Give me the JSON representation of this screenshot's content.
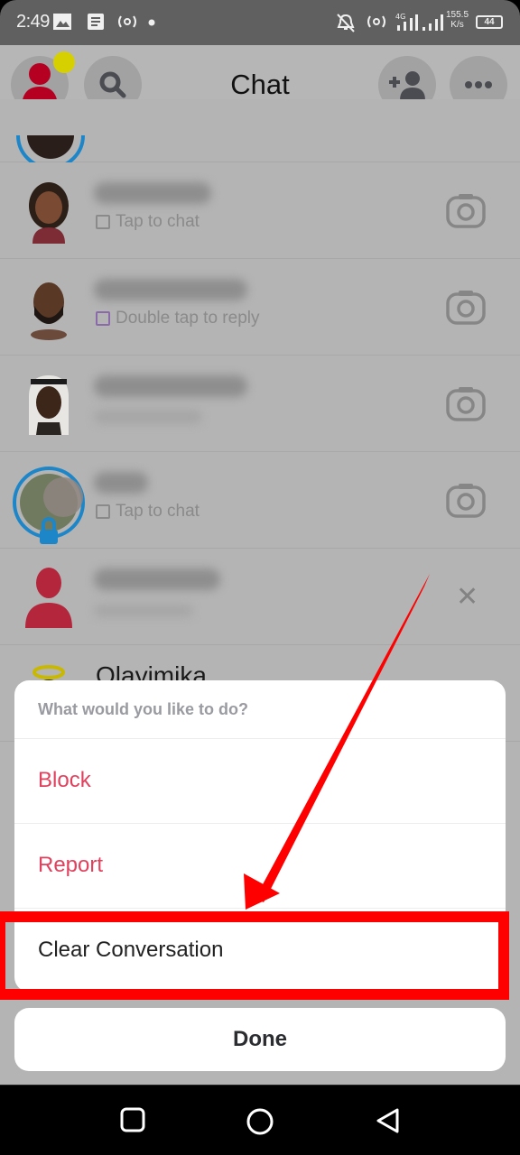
{
  "status_bar": {
    "time": "2:49",
    "speed_value": "155.5",
    "speed_unit": "K/s",
    "battery": "44",
    "icons": [
      "gallery-icon",
      "notes-icon",
      "hotspot-icon",
      "dot-icon",
      "bell-muted-icon",
      "hotspot-icon",
      "signal-icon",
      "signal-icon"
    ]
  },
  "header": {
    "title": "Chat",
    "buttons": [
      "profile-avatar",
      "search",
      "add-friend",
      "more-options"
    ]
  },
  "chat_list": [
    {
      "name": "",
      "status": "Tap to chat",
      "action": "camera"
    },
    {
      "name": "",
      "status": "Double tap to reply",
      "action": "camera"
    },
    {
      "name": "",
      "status": "",
      "action": "camera"
    },
    {
      "name": "",
      "status": "Tap to chat",
      "action": "camera"
    },
    {
      "name": "",
      "status": "",
      "action": "dismiss"
    },
    {
      "name": "Olayimika",
      "status": "",
      "action": ""
    }
  ],
  "action_sheet": {
    "prompt": "What would you like to do?",
    "options": [
      {
        "label": "Block",
        "color": "#e1415d"
      },
      {
        "label": "Report",
        "color": "#e1415d"
      },
      {
        "label": "Clear Conversation",
        "color": "#222222"
      }
    ],
    "done_label": "Done"
  },
  "annotation": {
    "highlight_color": "#ff0000",
    "highlighted_option": "Clear Conversation"
  },
  "nav_bar": {
    "buttons": [
      "recents",
      "home",
      "back"
    ]
  }
}
